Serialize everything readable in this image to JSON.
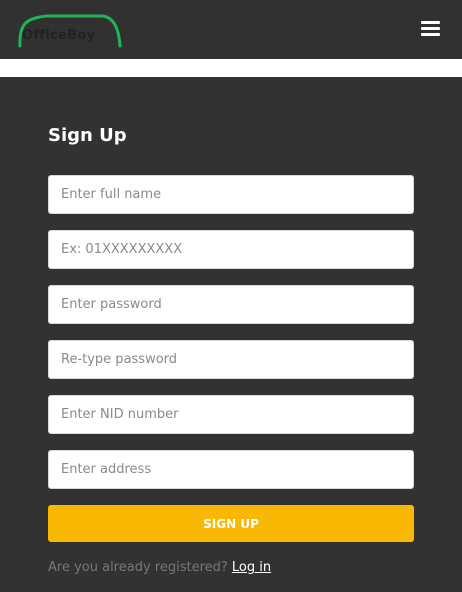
{
  "header": {
    "logo_text": "OfficeBoy",
    "brand_color": "#1fb35a",
    "menu_icon": "hamburger-menu-icon"
  },
  "form": {
    "title": "Sign Up",
    "fields": [
      {
        "placeholder": "Enter full name",
        "value": ""
      },
      {
        "placeholder": "Ex: 01XXXXXXXXX",
        "value": ""
      },
      {
        "placeholder": "Enter password",
        "value": ""
      },
      {
        "placeholder": "Re-type password",
        "value": ""
      },
      {
        "placeholder": "Enter NID number",
        "value": ""
      },
      {
        "placeholder": "Enter address",
        "value": ""
      }
    ],
    "submit_label": "SIGN UP",
    "submit_color": "#f8b804",
    "already_text": "Are you already registered?",
    "login_label": "Log in"
  }
}
